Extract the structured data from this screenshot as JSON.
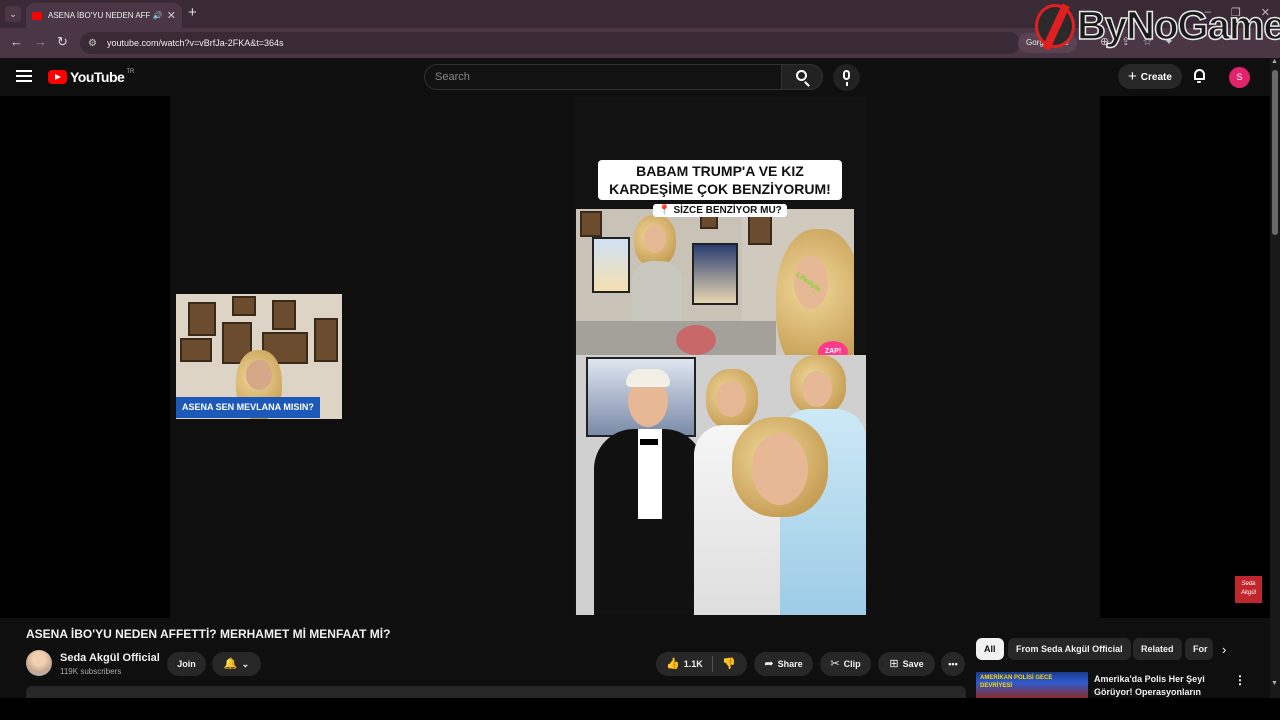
{
  "browser": {
    "tab_title": "ASENA İBO'YU NEDEN AFFE",
    "url": "youtube.com/watch?v=vBrfJa-2FKA&t=364s",
    "extension_chip": "Gorgul a Se"
  },
  "watermark": {
    "text": "ByNoGame"
  },
  "header": {
    "logo_text": "YouTube",
    "country_code": "TR",
    "search_placeholder": "Search",
    "create_label": "Create",
    "avatar_initial": "S"
  },
  "video_overlay": {
    "headline": "BABAM TRUMP'A VE KIZ KARDEŞİME ÇOK BENZİYORUM!",
    "subline": "SİZCE BENZİYOR MU?",
    "pip_caption": "ASENA SEN MEVLANA MISIN?",
    "sticker": "ZAP!",
    "corner_logo": "Seda Akgül"
  },
  "video": {
    "title": "ASENA İBO'YU NEDEN AFFETTİ? MERHAMET Mİ MENFAAT Mİ?",
    "channel_name": "Seda Akgül Official",
    "subscribers": "119K subscribers",
    "join_label": "Join",
    "like_count": "1.1K",
    "share_label": "Share",
    "clip_label": "Clip",
    "save_label": "Save"
  },
  "chips": {
    "all": "All",
    "from": "From Seda Akgül Official",
    "related": "Related",
    "for": "For"
  },
  "recommendation": {
    "thumb_text": "AMERİKAN POLİSİ GECE DEVRİYESİ",
    "title": "Amerika'da Polis Her Şeyi Görüyor! Operasyonların Perde"
  },
  "colors": {
    "youtube_red": "#ff0000",
    "avatar_pink": "#e2236b",
    "caption_blue": "#1d59b8"
  }
}
